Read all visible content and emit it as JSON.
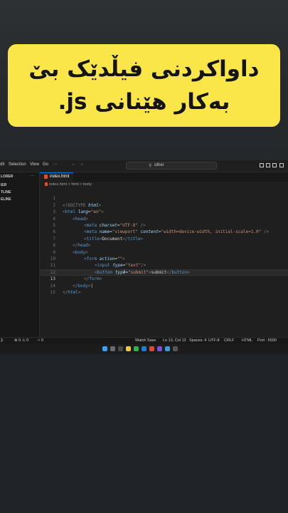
{
  "banner": {
    "line1": "داواکردنی  فیڵدێک بێ",
    "line2": "بەکار هێنانی js."
  },
  "titlebar": {
    "menu": [
      "dit",
      "Selection",
      "View",
      "Go",
      "···"
    ],
    "search_value": "other",
    "icons": [
      "arrow-left-icon",
      "arrow-right-icon",
      "search-icon"
    ]
  },
  "sidebar": {
    "header": "LORER",
    "items": [
      "IER",
      "TLINE",
      "ELINE"
    ]
  },
  "tab": {
    "label": "index.html"
  },
  "breadcrumb": {
    "file": "index.html",
    "sep1": ">",
    "tag1": "html",
    "sep2": ">",
    "tag2": "body"
  },
  "code_lines": [
    {
      "n": "1"
    },
    {
      "n": "2"
    },
    {
      "n": "3"
    },
    {
      "n": "4"
    },
    {
      "n": "5"
    },
    {
      "n": "6"
    },
    {
      "n": "7"
    },
    {
      "n": "8"
    },
    {
      "n": "9"
    },
    {
      "n": "10"
    },
    {
      "n": "11"
    },
    {
      "n": "12"
    },
    {
      "n": "13"
    },
    {
      "n": "14"
    },
    {
      "n": "15"
    }
  ],
  "code": {
    "doctype_open": "<!DOCTYPE ",
    "doctype_kw": "html",
    "doctype_close": ">",
    "html_tag": "html",
    "lang_attr": "lang",
    "lang_val": "\"en\"",
    "head": "head",
    "meta": "meta",
    "charset_attr": "charset",
    "charset_val": "\"UTF-8\"",
    "name_attr": "name",
    "name_val": "\"viewport\"",
    "content_attr": "content",
    "content_val": "\"width=device-width, initial-scale=1.0\"",
    "title": "title",
    "title_text": "Document",
    "body": "body",
    "form": "form",
    "action_attr": "action",
    "action_val": "\"\"",
    "input": "input",
    "type_attr": "type",
    "type_text_val": "\"text\"",
    "button": "button",
    "type_submit_val": "\"submit\"",
    "button_text": "submit"
  },
  "status": {
    "left": "⊗ 0 ⚠ 0",
    "ports": "⑂ 0",
    "watch": "Watch Sass",
    "position": "Ln 13, Col 12",
    "spaces": "Spaces: 4",
    "encoding": "UTF-8",
    "eol": "CRLF",
    "language": "HTML",
    "port": "Port : 5500"
  },
  "colors": {
    "banner_bg": "#fbe64a",
    "tag": "#569cd6",
    "attr": "#9cdcfe",
    "string": "#ce9178"
  }
}
